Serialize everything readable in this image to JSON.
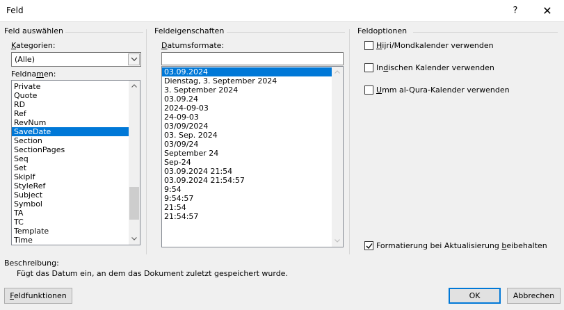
{
  "window": {
    "title": "Feld",
    "help_label": "?",
    "close_label": "✕"
  },
  "select_field": {
    "heading": "Feld auswählen",
    "categories_label_accel": "K",
    "categories_label_rest": "ategorien:",
    "category_value": "(Alle)",
    "field_names_label_pre": "Feldna",
    "field_names_label_accel": "m",
    "field_names_label_post": "en:",
    "field_names": [
      "Private",
      "Quote",
      "RD",
      "Ref",
      "RevNum",
      "SaveDate",
      "Section",
      "SectionPages",
      "Seq",
      "Set",
      "SkipIf",
      "StyleRef",
      "Subject",
      "Symbol",
      "TA",
      "TC",
      "Template",
      "Time"
    ],
    "selected_field": "SaveDate"
  },
  "field_properties": {
    "heading": "Feldeigenschaften",
    "date_formats_label_accel": "D",
    "date_formats_label_rest": "atumsformate:",
    "format_input_value": "",
    "date_formats": [
      "03.09.2024",
      "Dienstag, 3. September 2024",
      "3. September 2024",
      "03.09.24",
      "2024-09-03",
      "24-09-03",
      "03/09/2024",
      "03. Sep. 2024",
      "03/09/24",
      "September 24",
      "Sep-24",
      "03.09.2024 21:54",
      "03.09.2024 21:54:57",
      "9:54",
      "9:54:57",
      "21:54",
      "21:54:57"
    ],
    "selected_format": "03.09.2024"
  },
  "field_options": {
    "heading": "Feldoptionen",
    "hijri": {
      "accel": "H",
      "rest": "ijri/Mondkalender verwenden",
      "checked": false
    },
    "indian": {
      "pre": "In",
      "accel": "d",
      "post": "ischen Kalender verwenden",
      "checked": false
    },
    "umm": {
      "accel": "U",
      "rest": "mm al-Qura-Kalender verwenden",
      "checked": false
    },
    "preserve": {
      "pre": "Formatierung bei Aktualisierung ",
      "accel": "b",
      "post": "eibehalten",
      "checked": true
    }
  },
  "description": {
    "label": "Beschreibung:",
    "text": "Fügt das Datum ein, an dem das Dokument zuletzt gespeichert wurde."
  },
  "buttons": {
    "field_codes_accel": "F",
    "field_codes_rest": "eldfunktionen",
    "ok": "OK",
    "cancel": "Abbrechen"
  },
  "colors": {
    "selection": "#0078d7",
    "default_button_border": "#0078d7"
  }
}
